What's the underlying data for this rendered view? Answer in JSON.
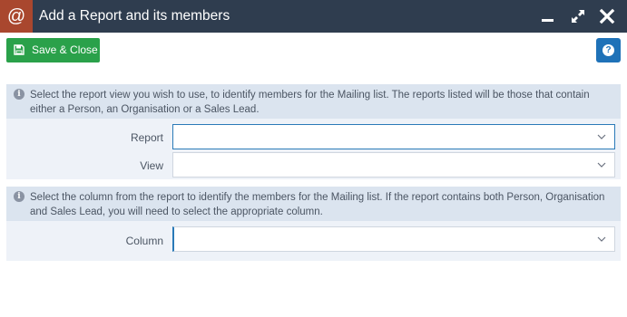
{
  "window": {
    "app_icon_glyph": "@",
    "title": "Add a Report and its members",
    "controls": [
      "minimize-icon",
      "maximize-icon",
      "close-icon"
    ]
  },
  "toolbar": {
    "save_label": "Save & Close",
    "save_icon": "floppy-disk-icon",
    "help_icon": "question-icon",
    "help_glyph": "?"
  },
  "section1": {
    "info_glyph": "i",
    "info_text": "Select the report view you wish to use, to identify members for the Mailing list. The reports listed will be those that contain either a Person, an Organisation or a Sales Lead.",
    "report_label": "Report",
    "report_value": "",
    "view_label": "View",
    "view_value": ""
  },
  "section2": {
    "info_glyph": "i",
    "info_text": "Select the column from the report to identify the members for the Mailing list. If the report contains both Person, Organisation and Sales Lead, you will need to select the appropriate column.",
    "column_label": "Column",
    "column_value": ""
  },
  "colors": {
    "titlebar": "#2f3d4f",
    "app_icon_bg": "#a9472e",
    "save_button": "#2aa14a",
    "help_button": "#1f72b8",
    "info_bg": "#dbe4ef",
    "panel_bg": "#eef2f8",
    "focus_border": "#2a7ab8"
  }
}
